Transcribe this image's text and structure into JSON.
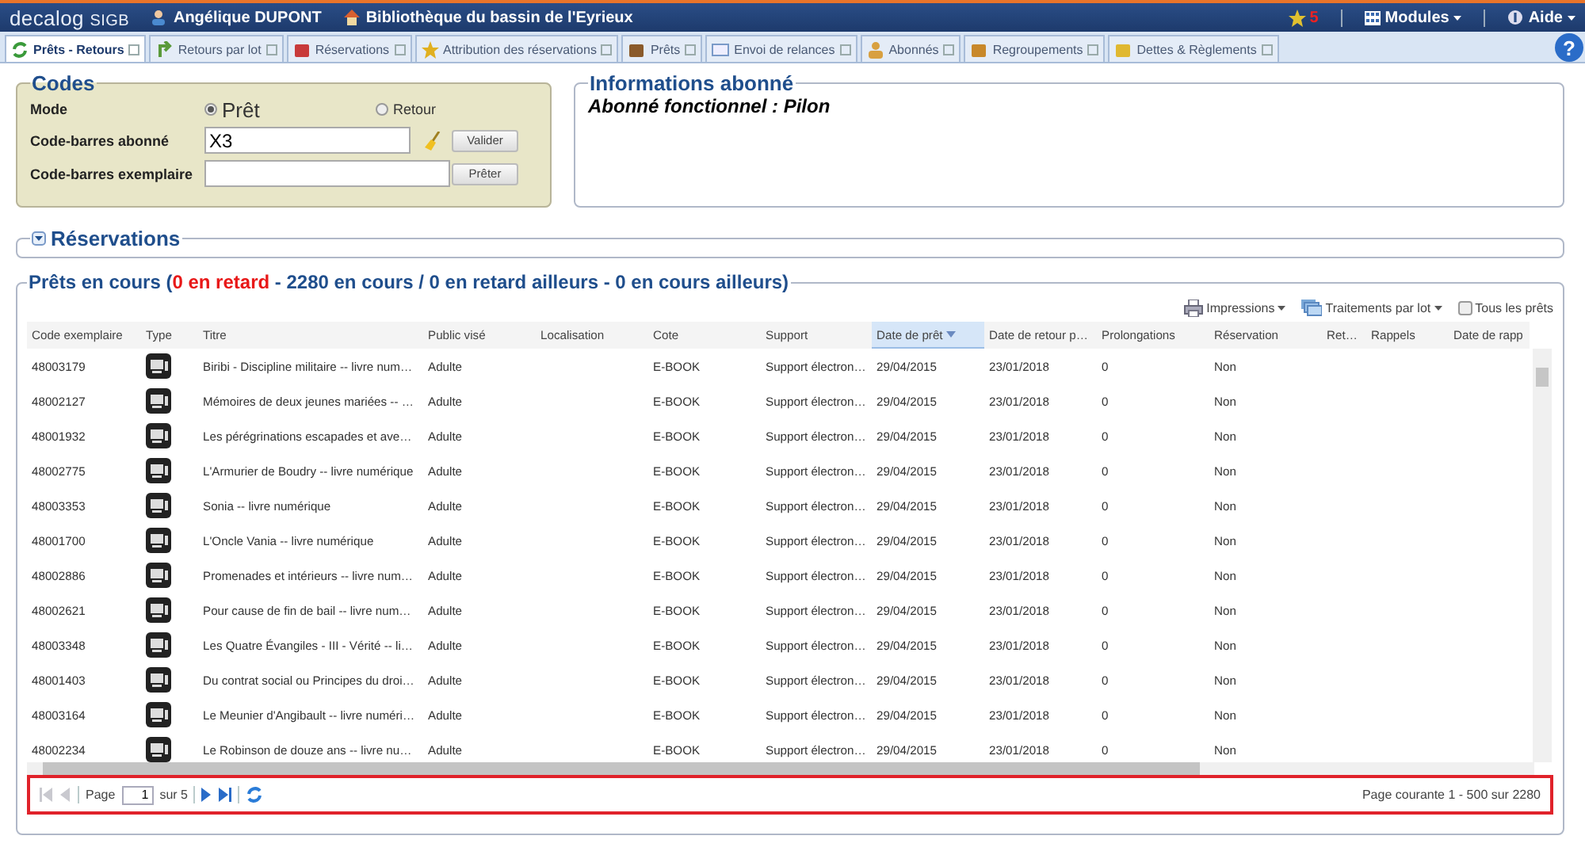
{
  "topbar": {
    "logo": "decalog",
    "logo_suffix": "SIGB",
    "user": "Angélique DUPONT",
    "library": "Bibliothèque du bassin de l'Eyrieux",
    "notifications": "5",
    "menus": [
      "Modules",
      "Aide"
    ]
  },
  "tabs": [
    {
      "label": "Prêts - Retours",
      "selected": true
    },
    {
      "label": "Retours par lot",
      "selected": false
    },
    {
      "label": "Réservations",
      "selected": false
    },
    {
      "label": "Attribution des réservations",
      "selected": false
    },
    {
      "label": "Prêts",
      "selected": false
    },
    {
      "label": "Envoi de relances",
      "selected": false
    },
    {
      "label": "Abonnés",
      "selected": false
    },
    {
      "label": "Regroupements",
      "selected": false
    },
    {
      "label": "Dettes & Règlements",
      "selected": false
    }
  ],
  "help": "?",
  "codes": {
    "title": "Codes",
    "mode_label": "Mode",
    "modes": [
      {
        "label": "Prêt",
        "selected": true
      },
      {
        "label": "Retour",
        "selected": false
      }
    ],
    "fields": [
      {
        "label": "Code-barres abonné",
        "value": "X3",
        "button": "Valider",
        "clear": true
      },
      {
        "label": "Code-barres exemplaire",
        "button": "Prêter",
        "clear": false
      }
    ]
  },
  "patron_info": {
    "title": "Informations abonné",
    "text": "Abonné fonctionnel : Pilon"
  },
  "reservations": {
    "title": "Réservations",
    "expanded": false
  },
  "loans": {
    "title_parts": [
      {
        "text": "Prêts en cours (",
        "kind": "normal"
      },
      {
        "text": "0 en retard",
        "kind": "alert"
      },
      {
        "text": " - 2280 en cours / 0 en retard ailleurs - 0 en cours ailleurs)",
        "kind": "normal"
      }
    ],
    "toolbar": [
      "Impressions",
      "Traitements par lot"
    ],
    "all_loans": {
      "label": "Tous les prêts",
      "checked": false
    },
    "columns": [
      {
        "label": "Code exemplaire",
        "sorted": false
      },
      {
        "label": "Type",
        "sorted": false
      },
      {
        "label": "Titre",
        "sorted": false
      },
      {
        "label": "Public visé",
        "sorted": false
      },
      {
        "label": "Localisation",
        "sorted": false
      },
      {
        "label": "Cote",
        "sorted": false
      },
      {
        "label": "Support",
        "sorted": false
      },
      {
        "label": "Date de prêt",
        "sorted": true
      },
      {
        "label": "Date de retour p…",
        "sorted": false
      },
      {
        "label": "Prolongations",
        "sorted": false
      },
      {
        "label": "Réservation",
        "sorted": false
      },
      {
        "label": "Ret…",
        "sorted": false
      },
      {
        "label": "Rappels",
        "sorted": false
      },
      {
        "label": "Date de rapp",
        "sorted": false
      }
    ],
    "rows": [
      {
        "code": "48003179",
        "title": "Biribi - Discipline militaire -- livre num…",
        "public": "Adulte",
        "cote": "E-BOOK",
        "support": "Support électron…",
        "loan_date": "29/04/2015",
        "due_date": "23/01/2018",
        "renewals": "0",
        "reservation": "Non"
      },
      {
        "code": "48002127",
        "title": "Mémoires de deux jeunes mariées -- …",
        "public": "Adulte",
        "cote": "E-BOOK",
        "support": "Support électron…",
        "loan_date": "29/04/2015",
        "due_date": "23/01/2018",
        "renewals": "0",
        "reservation": "Non"
      },
      {
        "code": "48001932",
        "title": "Les pérégrinations escapades et ave…",
        "public": "Adulte",
        "cote": "E-BOOK",
        "support": "Support électron…",
        "loan_date": "29/04/2015",
        "due_date": "23/01/2018",
        "renewals": "0",
        "reservation": "Non"
      },
      {
        "code": "48002775",
        "title": "L'Armurier de Boudry -- livre numérique",
        "public": "Adulte",
        "cote": "E-BOOK",
        "support": "Support électron…",
        "loan_date": "29/04/2015",
        "due_date": "23/01/2018",
        "renewals": "0",
        "reservation": "Non"
      },
      {
        "code": "48003353",
        "title": "Sonia -- livre numérique",
        "public": "Adulte",
        "cote": "E-BOOK",
        "support": "Support électron…",
        "loan_date": "29/04/2015",
        "due_date": "23/01/2018",
        "renewals": "0",
        "reservation": "Non"
      },
      {
        "code": "48001700",
        "title": "L'Oncle Vania -- livre numérique",
        "public": "Adulte",
        "cote": "E-BOOK",
        "support": "Support électron…",
        "loan_date": "29/04/2015",
        "due_date": "23/01/2018",
        "renewals": "0",
        "reservation": "Non"
      },
      {
        "code": "48002886",
        "title": "Promenades et intérieurs -- livre num…",
        "public": "Adulte",
        "cote": "E-BOOK",
        "support": "Support électron…",
        "loan_date": "29/04/2015",
        "due_date": "23/01/2018",
        "renewals": "0",
        "reservation": "Non"
      },
      {
        "code": "48002621",
        "title": "Pour cause de fin de bail -- livre num…",
        "public": "Adulte",
        "cote": "E-BOOK",
        "support": "Support électron…",
        "loan_date": "29/04/2015",
        "due_date": "23/01/2018",
        "renewals": "0",
        "reservation": "Non"
      },
      {
        "code": "48003348",
        "title": "Les Quatre Évangiles - III - Vérité -- li…",
        "public": "Adulte",
        "cote": "E-BOOK",
        "support": "Support électron…",
        "loan_date": "29/04/2015",
        "due_date": "23/01/2018",
        "renewals": "0",
        "reservation": "Non"
      },
      {
        "code": "48001403",
        "title": "Du contrat social ou Principes du droi…",
        "public": "Adulte",
        "cote": "E-BOOK",
        "support": "Support électron…",
        "loan_date": "29/04/2015",
        "due_date": "23/01/2018",
        "renewals": "0",
        "reservation": "Non"
      },
      {
        "code": "48003164",
        "title": "Le Meunier d'Angibault -- livre numéri…",
        "public": "Adulte",
        "cote": "E-BOOK",
        "support": "Support électron…",
        "loan_date": "29/04/2015",
        "due_date": "23/01/2018",
        "renewals": "0",
        "reservation": "Non"
      },
      {
        "code": "48002234",
        "title": "Le Robinson de douze ans -- livre nu…",
        "public": "Adulte",
        "cote": "E-BOOK",
        "support": "Support électron…",
        "loan_date": "29/04/2015",
        "due_date": "23/01/2018",
        "renewals": "0",
        "reservation": "Non"
      }
    ],
    "pager": {
      "page_label": "Page",
      "page": "1",
      "of": "sur 5",
      "first_disabled": true,
      "summary": "Page courante 1 - 500 sur 2280"
    }
  }
}
